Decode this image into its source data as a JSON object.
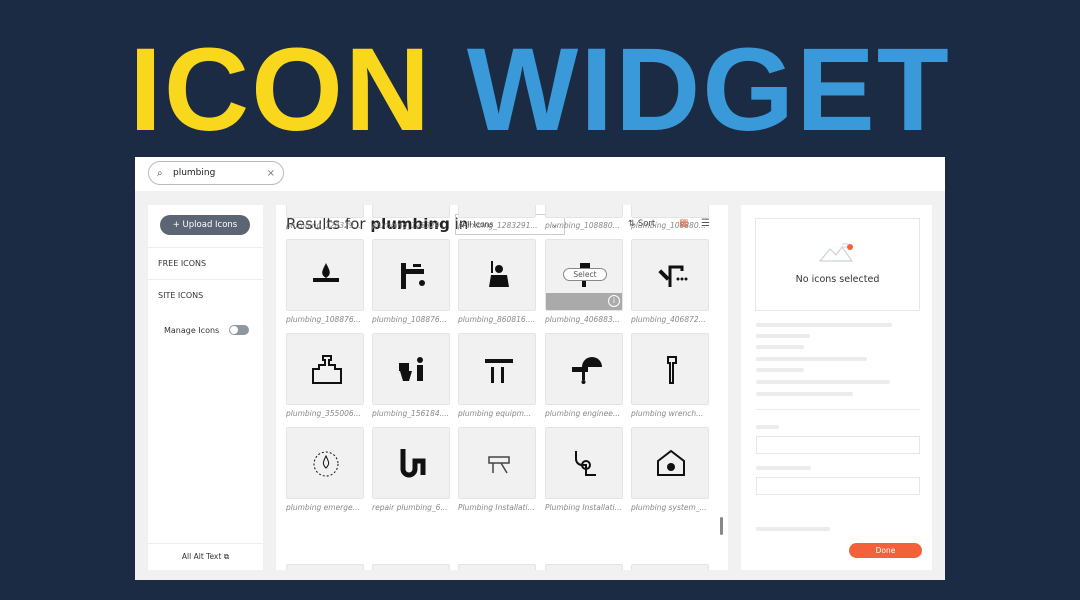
{
  "hero": {
    "word1": "ICON",
    "word2": "WIDGET",
    "color1": "#f9d71c",
    "color2": "#3a9ad9"
  },
  "search": {
    "value": "plumbing",
    "icon": "search-icon",
    "clear": "×"
  },
  "sidebar": {
    "upload_label": "+ Upload Icons",
    "items": [
      {
        "label": "FREE ICONS"
      },
      {
        "label": "SITE ICONS"
      }
    ],
    "manage_label": "Manage Icons",
    "alt_text_label": "All Alt Text ⧉"
  },
  "main": {
    "results_prefix": "Results for",
    "query": "plumbing",
    "results_suffix": "in",
    "filter": "All Icons",
    "sort_label": "⇅ Sort",
    "select_label": "Select",
    "top_labels": [
      "plumbing_128329...",
      "plumbing_128329...",
      "plumbing_1283291...",
      "plumbing_108880...",
      "plumbing_108880..."
    ],
    "icons": [
      {
        "label": "plumbing_108876...",
        "icon": "drop-wrench-icon"
      },
      {
        "label": "plumbing_108876...",
        "icon": "faucet-wrench-icon"
      },
      {
        "label": "plumbing_860816....",
        "icon": "plumber-person-icon"
      },
      {
        "label": "plumbing_406883...",
        "icon": "pipe-wrench-icon",
        "hovered": true
      },
      {
        "label": "plumbing_406872...",
        "icon": "shower-wrench-icon"
      },
      {
        "label": "plumbing_355006...",
        "icon": "valve-icon"
      },
      {
        "label": "plumbing_156184....",
        "icon": "toilet-plumber-icon"
      },
      {
        "label": "plumbing equipm...",
        "icon": "tools-faucet-icon"
      },
      {
        "label": "plumbing enginee...",
        "icon": "helmet-pipe-icon"
      },
      {
        "label": "plumbing wrench...",
        "icon": "wrench-icon"
      },
      {
        "label": "plumbing emerge...",
        "icon": "drop-badge-icon"
      },
      {
        "label": "repair plumbing_6...",
        "icon": "pipe-repair-icon"
      },
      {
        "label": "Plumbing Installati...",
        "icon": "sink-installation-icon"
      },
      {
        "label": "Plumbing Installati...",
        "icon": "pipes-icon"
      },
      {
        "label": "plumbing system_...",
        "icon": "house-pipe-icon"
      }
    ]
  },
  "details": {
    "empty_text": "No icons selected",
    "done_label": "Done",
    "accent": "#f2613a"
  }
}
